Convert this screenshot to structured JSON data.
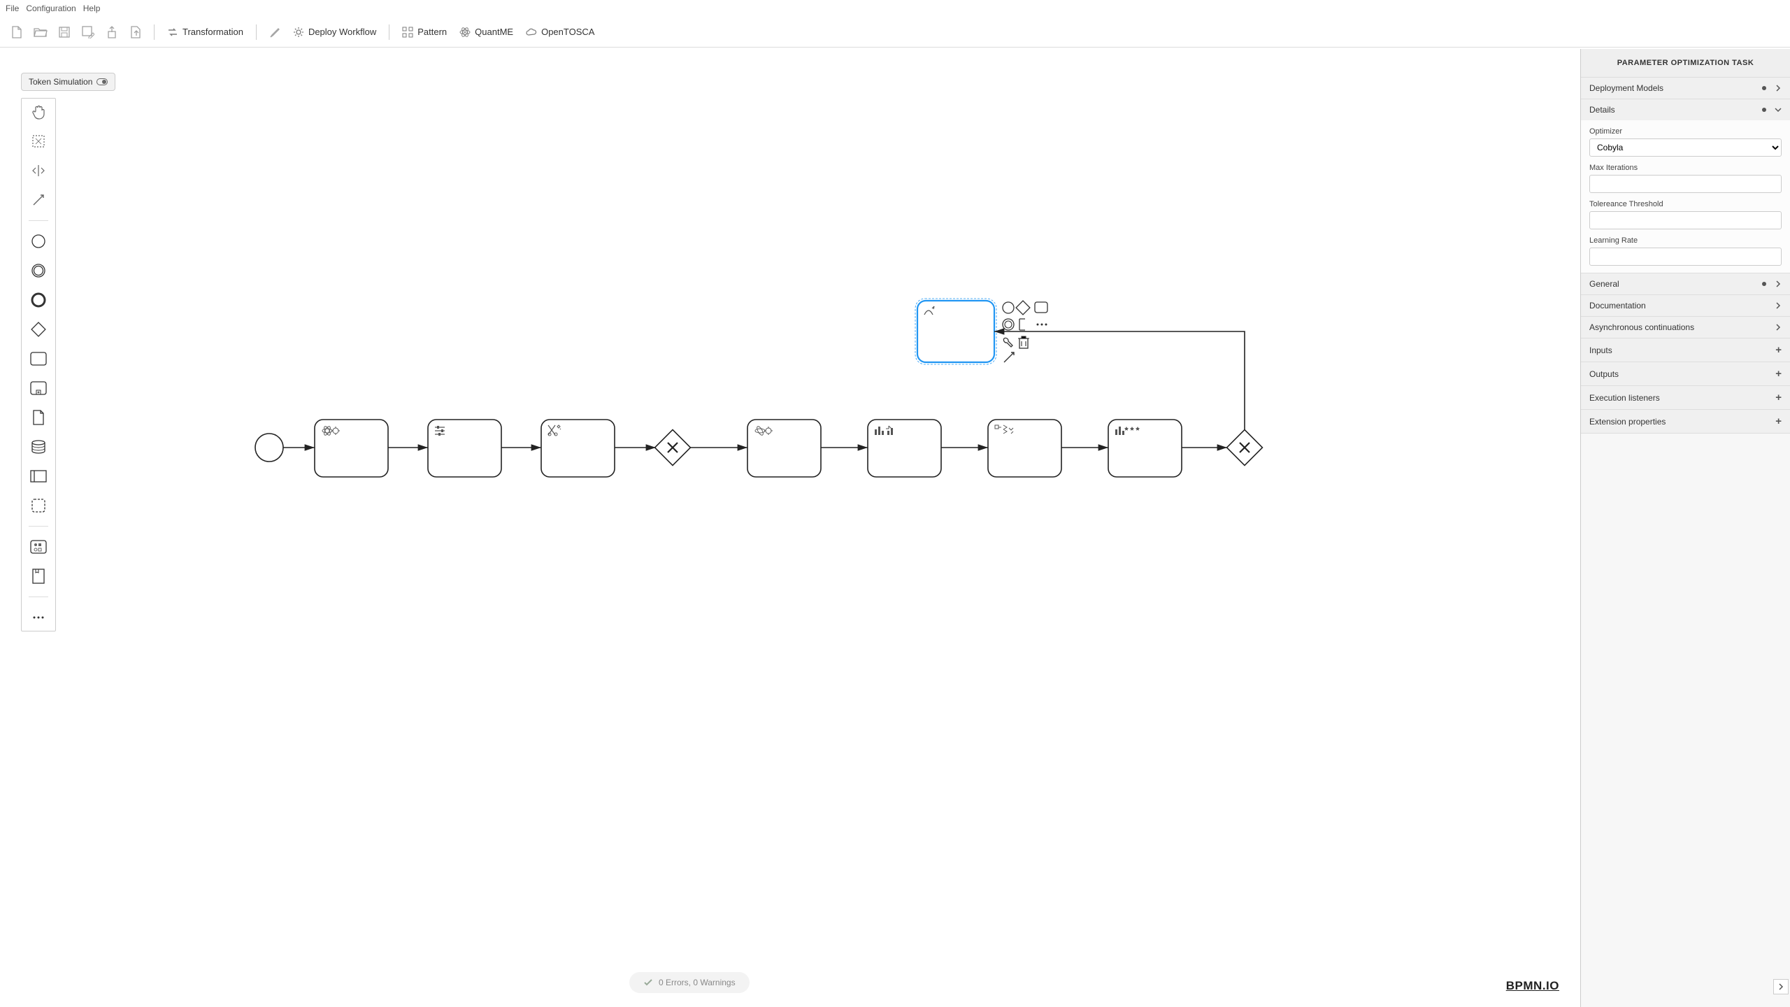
{
  "menubar": {
    "items": [
      "File",
      "Configuration",
      "Help"
    ]
  },
  "toolbar": {
    "transformation": "Transformation",
    "deploy": "Deploy Workflow",
    "pattern": "Pattern",
    "quantme": "QuantME",
    "opentosca": "OpenTOSCA"
  },
  "tokenSim": {
    "label": "Token Simulation"
  },
  "status": {
    "text": "0 Errors, 0 Warnings"
  },
  "watermark": "BPMN.IO",
  "props": {
    "title": "PARAMETER OPTIMIZATION TASK",
    "sections": {
      "deployment": "Deployment Models",
      "details": "Details",
      "general": "General",
      "documentation": "Documentation",
      "async": "Asynchronous continuations",
      "inputs": "Inputs",
      "outputs": "Outputs",
      "execListeners": "Execution listeners",
      "extProps": "Extension properties"
    },
    "details": {
      "optimizerLabel": "Optimizer",
      "optimizerValue": "Cobyla",
      "maxIterLabel": "Max Iterations",
      "maxIterValue": "",
      "tolLabel": "Tolereance Threshold",
      "tolValue": "",
      "lrLabel": "Learning Rate",
      "lrValue": ""
    }
  }
}
